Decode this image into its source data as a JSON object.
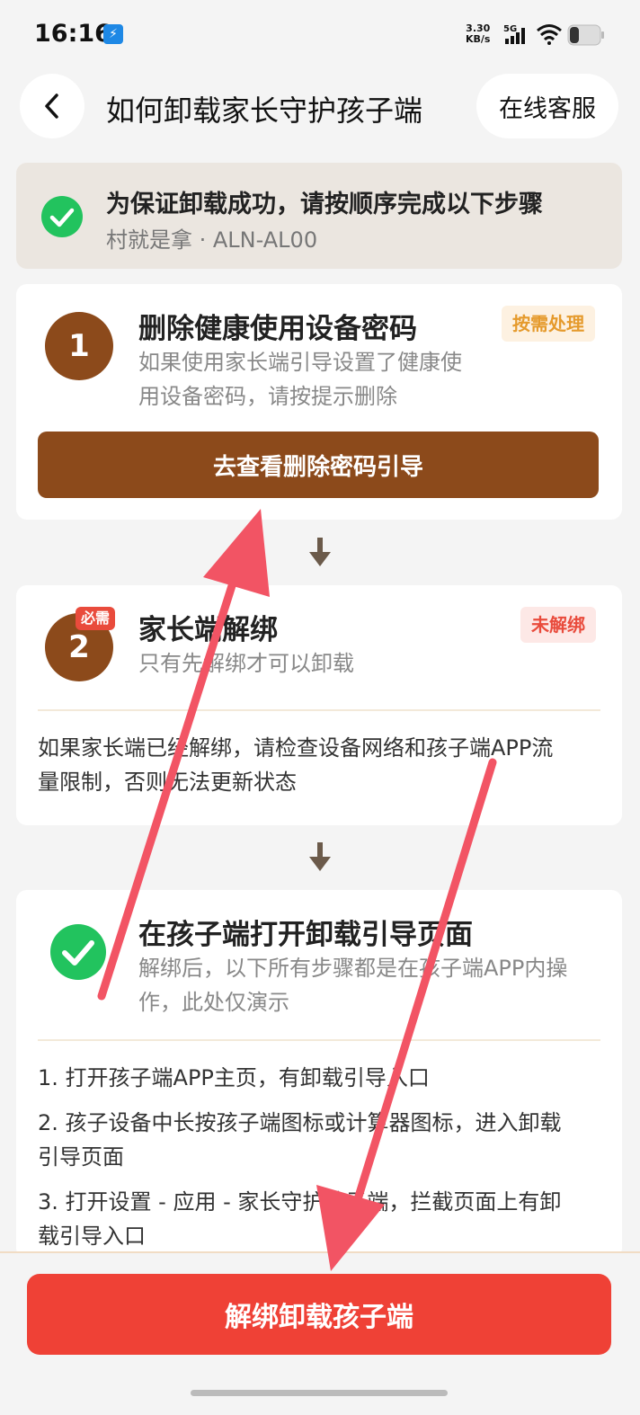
{
  "status_bar": {
    "time": "16:16",
    "usb_icon": "usb-icon",
    "net_speed_value": "3.30",
    "net_speed_unit": "KB/s",
    "network_type": "5G"
  },
  "header": {
    "title": "如何卸载家长守护孩子端",
    "service_label": "在线客服"
  },
  "notice": {
    "title": "为保证卸载成功，请按顺序完成以下步骤",
    "device": "村就是拿 · ALN-AL00"
  },
  "steps": [
    {
      "number": "1",
      "title": "删除健康使用设备密码",
      "tag": "按需处理",
      "desc_line1": "如果使用家长端引导设置了健康使",
      "desc_line2": "用设备密码，请按提示删除",
      "button": "去查看删除密码引导"
    },
    {
      "number": "2",
      "badge": "必需",
      "title": "家长端解绑",
      "tag": "未解绑",
      "desc": "只有先解绑才可以卸载",
      "note_line1": "如果家长端已经解绑，请检查设备网络和孩子端APP流",
      "note_line2": "量限制，否则无法更新状态"
    },
    {
      "title": "在孩子端打开卸载引导页面",
      "desc_line1": "解绑后，以下所有步骤都是在孩子端APP内操",
      "desc_line2": "作，此处仅演示",
      "items": [
        "1. 打开孩子端APP主页，有卸载引导入口",
        "2. 孩子设备中长按孩子端图标或计算器图标，进入卸载",
        "引导页面",
        "3. 打开设置 - 应用 - 家长守护孩子端，拦截页面上有卸",
        "载引导入口"
      ]
    }
  ],
  "bottom": {
    "primary_button": "解绑卸载孩子端"
  },
  "colors": {
    "brown": "#8c4a1b",
    "red": "#ef4136",
    "green": "#22c35e",
    "annotation_arrow": "#f25464"
  }
}
